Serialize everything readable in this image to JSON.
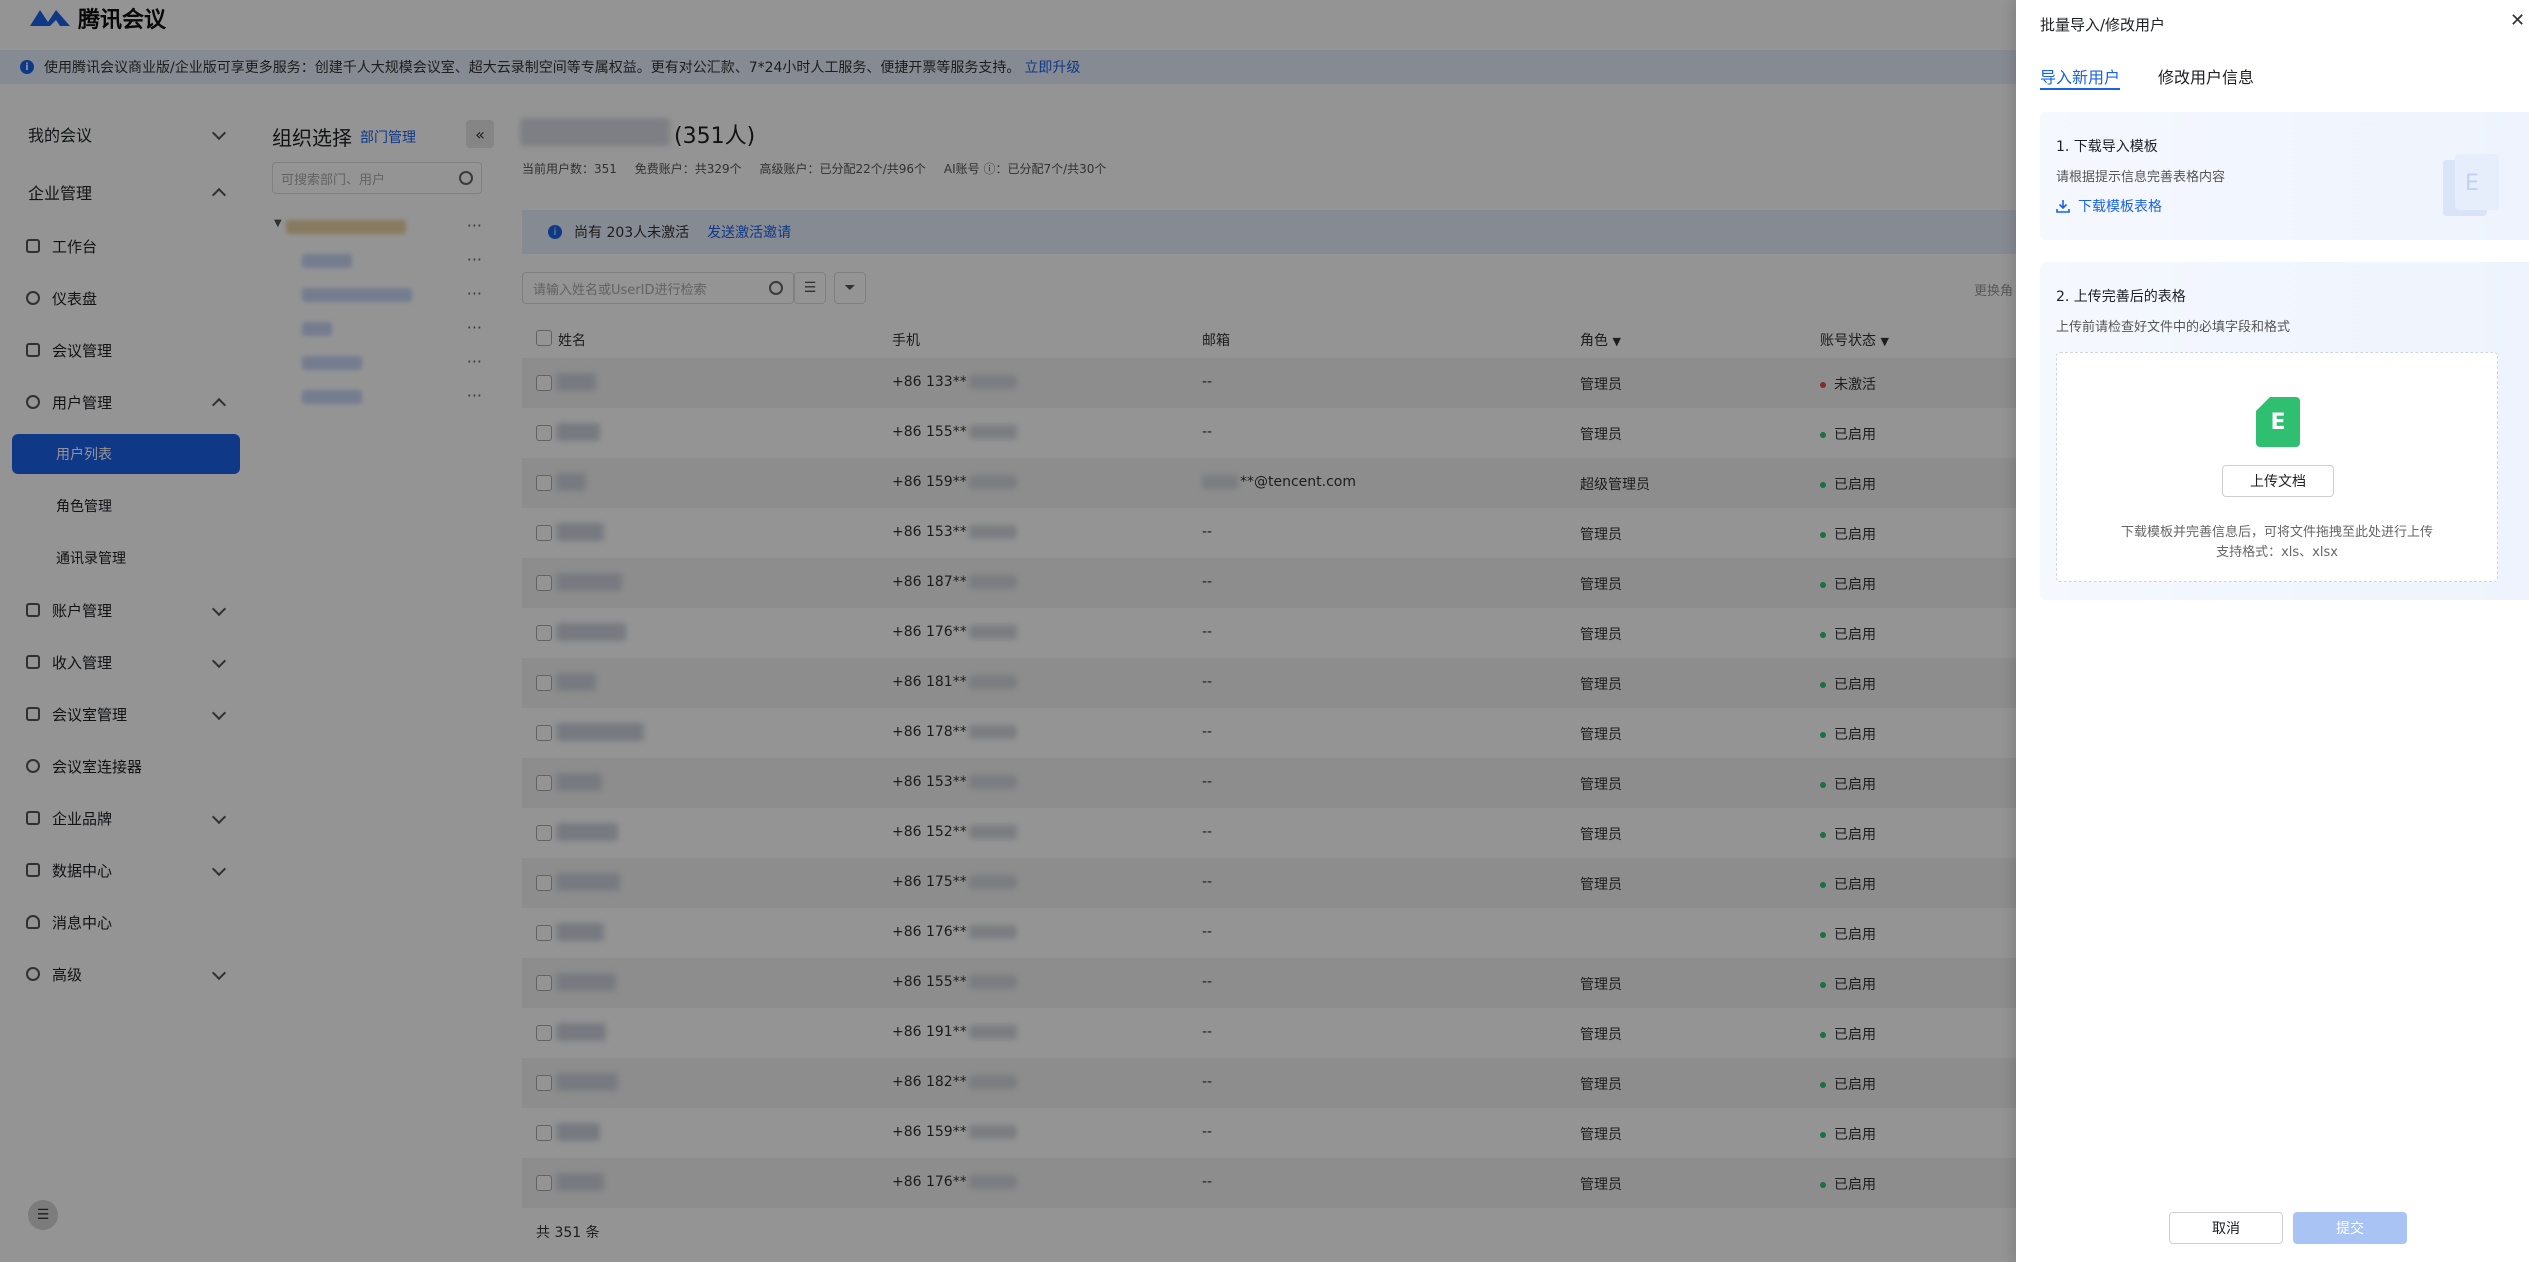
{
  "app": {
    "logo_text": "腾讯会议"
  },
  "notice": {
    "text": "使用腾讯会议商业版/企业版可享更多服务：创建千人大规模会议室、超大云录制空间等专属权益。更有对公汇款、7*24小时人工服务、便捷开票等服务支持。",
    "link": "立即升级"
  },
  "sidebar": {
    "items": [
      {
        "label": "我的会议"
      },
      {
        "label": "企业管理"
      },
      {
        "label": "工作台"
      },
      {
        "label": "仪表盘"
      },
      {
        "label": "会议管理"
      },
      {
        "label": "用户管理"
      },
      {
        "label": "用户列表"
      },
      {
        "label": "角色管理"
      },
      {
        "label": "通讯录管理"
      },
      {
        "label": "账户管理"
      },
      {
        "label": "收入管理"
      },
      {
        "label": "会议室管理"
      },
      {
        "label": "会议室连接器"
      },
      {
        "label": "企业品牌"
      },
      {
        "label": "数据中心"
      },
      {
        "label": "消息中心"
      },
      {
        "label": "高级"
      }
    ]
  },
  "org": {
    "title": "组织选择",
    "manage_link": "部门管理",
    "search_placeholder": "可搜索部门、用户"
  },
  "content": {
    "count": "(351人)",
    "stats": [
      "当前用户数：351",
      "免费账户：共329个",
      "高级账户：已分配22个/共96个",
      "AI账号 ⓘ：已分配7个/共30个"
    ],
    "alert_text": "尚有 203人未激活",
    "alert_link": "发送激活邀请",
    "search_placeholder": "请输入姓名或UserID进行检索",
    "partial_header": "更换角",
    "columns": {
      "name": "姓名",
      "phone": "手机",
      "email": "邮箱",
      "role": "角色",
      "status": "账号状态"
    },
    "rows": [
      {
        "phone": "+86 133**",
        "email": "--",
        "email_suffix": "",
        "role": "管理员",
        "status": "未激活"
      },
      {
        "phone": "+86 155**",
        "email": "--",
        "email_suffix": "",
        "role": "管理员",
        "status": "已启用"
      },
      {
        "phone": "+86 159**",
        "email": "",
        "email_suffix": "**@tencent.com",
        "role": "超级管理员",
        "status": "已启用"
      },
      {
        "phone": "+86 153**",
        "email": "--",
        "email_suffix": "",
        "role": "管理员",
        "status": "已启用"
      },
      {
        "phone": "+86 187**",
        "email": "--",
        "email_suffix": "",
        "role": "管理员",
        "status": "已启用"
      },
      {
        "phone": "+86 176**",
        "email": "--",
        "email_suffix": "",
        "role": "管理员",
        "status": "已启用"
      },
      {
        "phone": "+86 181**",
        "email": "--",
        "email_suffix": "",
        "role": "管理员",
        "status": "已启用"
      },
      {
        "phone": "+86 178**",
        "email": "--",
        "email_suffix": "",
        "role": "管理员",
        "status": "已启用"
      },
      {
        "phone": "+86 153**",
        "email": "--",
        "email_suffix": "",
        "role": "管理员",
        "status": "已启用"
      },
      {
        "phone": "+86 152**",
        "email": "--",
        "email_suffix": "",
        "role": "管理员",
        "status": "已启用"
      },
      {
        "phone": "+86 175**",
        "email": "--",
        "email_suffix": "",
        "role": "管理员",
        "status": "已启用"
      },
      {
        "phone": "+86 176**",
        "email": "--",
        "email_suffix": "",
        "role": "",
        "status": "已启用"
      },
      {
        "phone": "+86 155**",
        "email": "--",
        "email_suffix": "",
        "role": "管理员",
        "status": "已启用"
      },
      {
        "phone": "+86 191**",
        "email": "--",
        "email_suffix": "",
        "role": "管理员",
        "status": "已启用"
      },
      {
        "phone": "+86 182**",
        "email": "--",
        "email_suffix": "",
        "role": "管理员",
        "status": "已启用"
      },
      {
        "phone": "+86 159**",
        "email": "--",
        "email_suffix": "",
        "role": "管理员",
        "status": "已启用"
      },
      {
        "phone": "+86 176**",
        "email": "--",
        "email_suffix": "",
        "role": "管理员",
        "status": "已启用"
      }
    ],
    "footer": "共 351 条"
  },
  "drawer": {
    "title": "批量导入/修改用户",
    "tabs": [
      "导入新用户",
      "修改用户信息"
    ],
    "step1": {
      "title": "1. 下载导入模板",
      "desc": "请根据提示信息完善表格内容",
      "link": "下载模板表格"
    },
    "step2": {
      "title": "2. 上传完善后的表格",
      "desc": "上传前请检查好文件中的必填字段和格式",
      "upload_button": "上传文档",
      "hint1": "下载模板并完善信息后，可将文件拖拽至此处进行上传",
      "hint2": "支持格式：xls、xlsx"
    },
    "cancel": "取消",
    "submit": "提交"
  },
  "colors": {
    "accent": "#1a62e8",
    "status_active": "#2fbf71",
    "status_inactive": "#e5484d",
    "excel": "#2fbf71"
  },
  "icons": [
    "logo-icon",
    "info-icon",
    "chevron-down-icon",
    "chevron-up-icon",
    "search-icon",
    "list-icon",
    "filter-icon",
    "more-icon",
    "close-icon",
    "download-icon",
    "excel-file-icon",
    "collapse-icon"
  ]
}
